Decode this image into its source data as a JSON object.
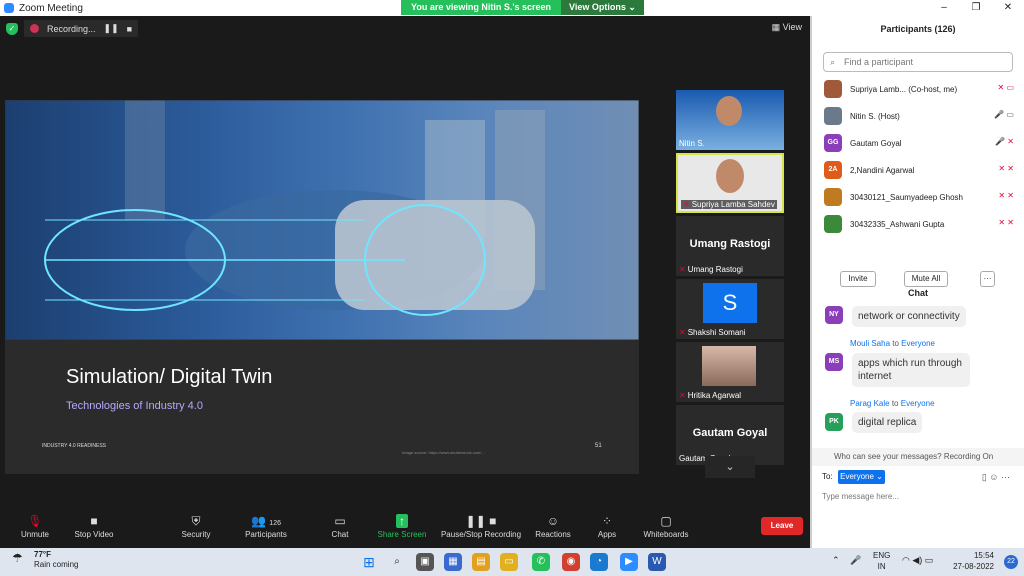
{
  "window": {
    "title": "Zoom Meeting",
    "controls": [
      "–",
      "❐",
      "✕"
    ]
  },
  "banner": {
    "viewing": "You are viewing Nitin S.'s screen",
    "view_options": "View Options ⌄"
  },
  "status": {
    "recording": "Recording...",
    "view": "View"
  },
  "slide": {
    "title": "Simulation/ Digital Twin",
    "subtitle": "Technologies of Industry 4.0",
    "footer": "INDUSTRY 4.0 READINESS",
    "number": "51",
    "source": "Image source: https://www.shutterstock.com/..."
  },
  "videos": [
    {
      "name": "Nitin S.",
      "big": ""
    },
    {
      "name": "Supriya Lamba  Sahdev",
      "big": ""
    },
    {
      "name": "Umang Rastogi",
      "big": "Umang Rastogi"
    },
    {
      "name": "Shakshi Somani",
      "big": "",
      "initial": "S"
    },
    {
      "name": "Hritika Agarwal",
      "big": ""
    },
    {
      "name": "Gautam Goyal",
      "big": "Gautam Goyal"
    }
  ],
  "toolbar": {
    "unmute": "Unmute",
    "stop_video": "Stop Video",
    "security": "Security",
    "participants": "Participants",
    "participants_count": "126",
    "chat": "Chat",
    "share_screen": "Share Screen",
    "recording": "Pause/Stop Recording",
    "reactions": "Reactions",
    "apps": "Apps",
    "whiteboards": "Whiteboards",
    "leave": "Leave"
  },
  "participants_panel": {
    "title": "Participants (126)",
    "search_placeholder": "Find a participant",
    "list": [
      {
        "name": "Supriya Lamb... (Co-host, me)",
        "initials": "",
        "color": "#a05a3a"
      },
      {
        "name": "Nitin S. (Host)",
        "initials": "",
        "color": "#6a7a8a"
      },
      {
        "name": "Gautam Goyal",
        "initials": "GG",
        "color": "#8a3fb8"
      },
      {
        "name": "2,Nandini Agarwal",
        "initials": "2A",
        "color": "#e05a1a"
      },
      {
        "name": "30430121_Saumyadeep Ghosh",
        "initials": "",
        "color": "#c07a20"
      },
      {
        "name": "30432335_Ashwani Gupta",
        "initials": "",
        "color": "#3a8a3a"
      }
    ],
    "invite": "Invite",
    "mute_all": "Mute All",
    "more": "···"
  },
  "chat": {
    "title": "Chat",
    "messages": [
      {
        "initials": "NY",
        "color": "#8a3fb8",
        "from": "",
        "to": "",
        "text": "network or connectivity"
      },
      {
        "initials": "MS",
        "color": "#8a3fb8",
        "from": "Mouli Saha",
        "to": "Everyone",
        "text": "apps which run through internet"
      },
      {
        "initials": "PK",
        "color": "#25a05b",
        "from": "Parag Kale",
        "to": "Everyone",
        "text": "digital replica"
      }
    ],
    "to_word": "to",
    "who_can_see": "Who can see your messages? Recording On",
    "to_label": "To:",
    "recipient": "Everyone ⌄",
    "placeholder": "Type message here..."
  },
  "taskbar": {
    "weather_temp": "77°F",
    "weather_desc": "Rain coming",
    "lang1": "ENG",
    "lang2": "IN",
    "time": "15:54",
    "date": "27-08-2022",
    "badge": "22"
  }
}
